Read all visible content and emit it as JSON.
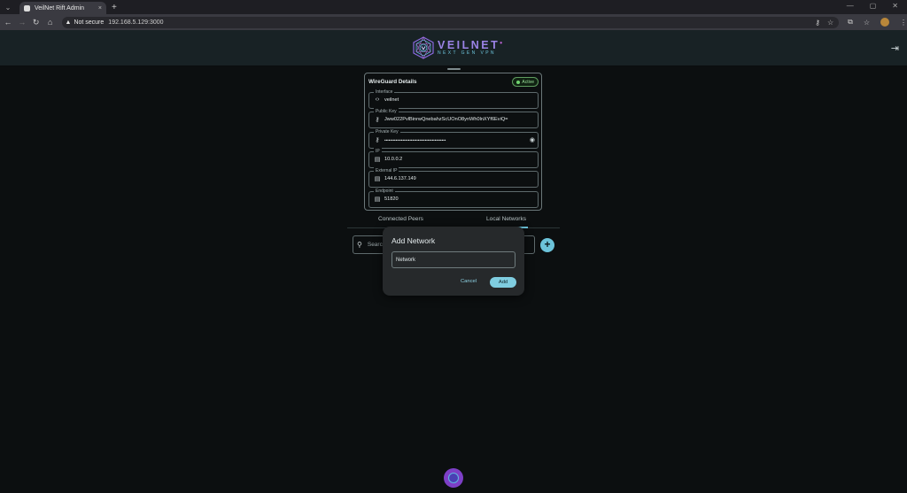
{
  "browser": {
    "tab_title": "VeilNet Rift Admin",
    "tab_close": "×",
    "new_tab": "+",
    "security_label": "Not secure",
    "url": "192.168.5.129:3000",
    "window_controls": [
      "—",
      "▢",
      "✕"
    ]
  },
  "app": {
    "logo_title": "VEILNET",
    "logo_dot": "•",
    "logo_subtitle": "NEXT GEN VPN",
    "colors": {
      "accent": "#6cc3da",
      "brand_purple": "#9b83e6",
      "active_green": "#6fd46f"
    }
  },
  "wireguard": {
    "title": "WireGuard Details",
    "status": "Active",
    "fields": [
      {
        "label": "Interface",
        "value": "veilnet",
        "icon": "code-icon"
      },
      {
        "label": "Public Key",
        "value": "Jww022PvlBinrwQnebahzScUOnO8ynWh0lnXYf6EviQ=",
        "icon": "key-icon"
      },
      {
        "label": "Private Key",
        "value": "••••••••••••••••••••••••••••••••••••••••••••",
        "icon": "key-icon"
      },
      {
        "label": "IP",
        "value": "10.0.0.2",
        "icon": "server-icon"
      },
      {
        "label": "External IP",
        "value": "144.6.137.149",
        "icon": "server-icon"
      },
      {
        "label": "Endpoint",
        "value": "51820",
        "icon": "server-icon"
      }
    ]
  },
  "tabs": [
    {
      "label": "Connected Peers",
      "active": false
    },
    {
      "label": "Local Networks",
      "active": true
    }
  ],
  "search": {
    "placeholder": "Search"
  },
  "dialog": {
    "title": "Add Network",
    "input_placeholder": "Network",
    "cancel_label": "Cancel",
    "add_label": "Add"
  }
}
